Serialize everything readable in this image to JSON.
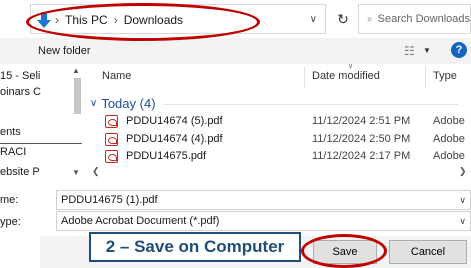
{
  "address": {
    "crumbs": [
      "This PC",
      "Downloads"
    ],
    "separator": "›"
  },
  "search": {
    "placeholder": "Search Downloads"
  },
  "toolbar": {
    "new_folder": "New folder",
    "help": "?"
  },
  "nav_pane": {
    "items": [
      "15 - Seli",
      "oinars C",
      "ents",
      "RACI",
      "ebsite P"
    ]
  },
  "columns": {
    "name": "Name",
    "date_modified": "Date modified",
    "type": "Type"
  },
  "group": {
    "label": "Today (4)"
  },
  "files": [
    {
      "name": "PDDU14674 (5).pdf",
      "date": "11/12/2024 2:51 PM",
      "type": "Adobe"
    },
    {
      "name": "PDDU14674 (4).pdf",
      "date": "11/12/2024 2:50 PM",
      "type": "Adobe"
    },
    {
      "name": "PDDU14675.pdf",
      "date": "11/12/2024 2:17 PM",
      "type": "Adobe"
    }
  ],
  "save_form": {
    "filename_label": "me:",
    "filename_value": "PDDU14675 (1).pdf",
    "type_label": "ype:",
    "type_value": "Adobe Acrobat Document (*.pdf)"
  },
  "callout": {
    "text": "2 – Save on Computer"
  },
  "buttons": {
    "save": "Save",
    "cancel": "Cancel"
  },
  "colors": {
    "highlight_ring": "#c00000",
    "callout": "#1f4e79",
    "accent": "#1565c0",
    "pdf": "#c62828"
  }
}
